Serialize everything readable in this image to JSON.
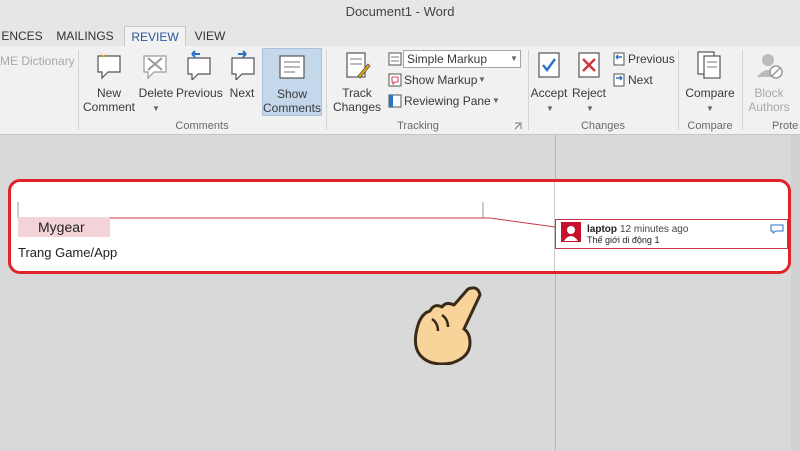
{
  "window": {
    "title": "Document1 - Word"
  },
  "tabs": [
    {
      "label": "ENCES"
    },
    {
      "label": "MAILINGS"
    },
    {
      "label": "REVIEW"
    },
    {
      "label": "VIEW"
    }
  ],
  "ribbon": {
    "dictionary": "ME Dictionary",
    "comments": {
      "new_label": "New\nComment",
      "delete_label": "Delete",
      "previous_label": "Previous",
      "next_label": "Next",
      "show_label": "Show\nComments",
      "group_label": "Comments"
    },
    "tracking": {
      "track_label": "Track\nChanges",
      "markup_select": "Simple Markup",
      "show_markup": "Show Markup",
      "reviewing_pane": "Reviewing Pane",
      "group_label": "Tracking"
    },
    "changes": {
      "accept_label": "Accept",
      "reject_label": "Reject",
      "previous_label": "Previous",
      "next_label": "Next",
      "group_label": "Changes"
    },
    "compare": {
      "compare_label": "Compare",
      "group_label": "Compare"
    },
    "protect": {
      "block_label": "Block\nAuthors",
      "group_label": "Prote"
    }
  },
  "document": {
    "commented_text": "Mygear",
    "line2": "Trang Game/App"
  },
  "comment": {
    "author": "laptop",
    "time": "12 minutes ago",
    "text": "Thế giới di động 1"
  },
  "colors": {
    "accent": "#2b579a",
    "highlight_border": "#e0242b",
    "comment_mark": "#c8102e"
  }
}
